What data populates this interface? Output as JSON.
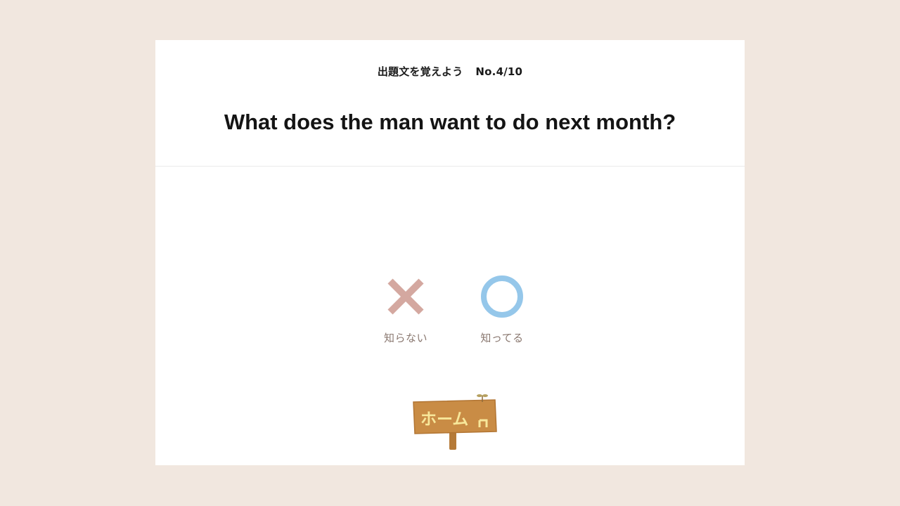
{
  "header": {
    "subtitle": "出題文を覚えよう",
    "number": "No.4/10"
  },
  "question": {
    "text": "What does the man want to do next month?"
  },
  "answers": {
    "unknown": {
      "label": "知らない",
      "icon": "cross-icon",
      "color": "#d4a8a0"
    },
    "known": {
      "label": "知ってる",
      "icon": "circle-icon",
      "color": "#95c7ea"
    }
  },
  "home": {
    "label": "ホーム",
    "icon": "home-signboard-icon",
    "board_color": "#c98c45",
    "text_color": "#f7e79a"
  },
  "colors": {
    "background": "#f1e7df",
    "card": "#ffffff"
  }
}
